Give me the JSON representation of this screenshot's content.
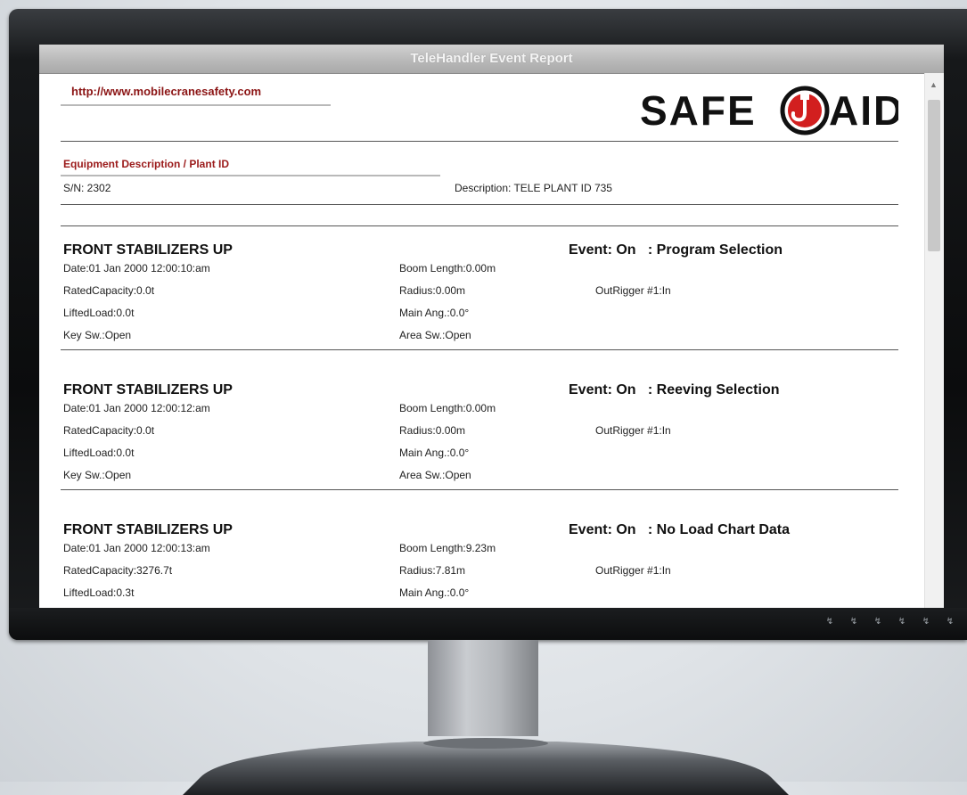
{
  "window": {
    "title": "TeleHandler Event Report"
  },
  "header": {
    "url": "http://www.mobilecranesafety.com",
    "logo_text_left": "SAFE",
    "logo_text_right": "AID"
  },
  "equipment": {
    "section_title": "Equipment Description / Plant ID",
    "serial": "S/N: 2302",
    "description": "Description: TELE PLANT ID 735"
  },
  "events": [
    {
      "title": "FRONT STABILIZERS UP",
      "event": "Event: On   : Program Selection",
      "date": "Date:01 Jan 2000 12:00:10:am",
      "boom_length": "Boom Length:0.00m",
      "rated_capacity": "RatedCapacity:0.0t",
      "radius": "Radius:0.00m",
      "outrigger": "OutRigger #1:In",
      "lifted_load": "LiftedLoad:0.0t",
      "main_ang": "Main Ang.:0.0°",
      "key_sw": "Key Sw.:Open",
      "area_sw": "Area Sw.:Open"
    },
    {
      "title": "FRONT STABILIZERS UP",
      "event": "Event: On   : Reeving Selection",
      "date": "Date:01 Jan 2000 12:00:12:am",
      "boom_length": "Boom Length:0.00m",
      "rated_capacity": "RatedCapacity:0.0t",
      "radius": "Radius:0.00m",
      "outrigger": "OutRigger #1:In",
      "lifted_load": "LiftedLoad:0.0t",
      "main_ang": "Main Ang.:0.0°",
      "key_sw": "Key Sw.:Open",
      "area_sw": "Area Sw.:Open"
    },
    {
      "title": "FRONT STABILIZERS UP",
      "event": "Event: On   : No Load Chart Data",
      "date": "Date:01 Jan 2000 12:00:13:am",
      "boom_length": "Boom Length:9.23m",
      "rated_capacity": "RatedCapacity:3276.7t",
      "radius": "Radius:7.81m",
      "outrigger": "OutRigger #1:In",
      "lifted_load": "LiftedLoad:0.3t",
      "main_ang": "Main Ang.:0.0°",
      "key_sw": "",
      "area_sw": ""
    }
  ],
  "monitor": {
    "buttons": [
      "power-icon",
      "menu-icon",
      "brightness-icon",
      "input-icon",
      "plus-icon",
      "minus-icon"
    ],
    "button_glyphs": [
      "↯",
      "↯",
      "↯",
      "↯",
      "↯",
      "↯"
    ]
  },
  "colors": {
    "accent": "#8b1414",
    "logo_red": "#d21f1f"
  }
}
